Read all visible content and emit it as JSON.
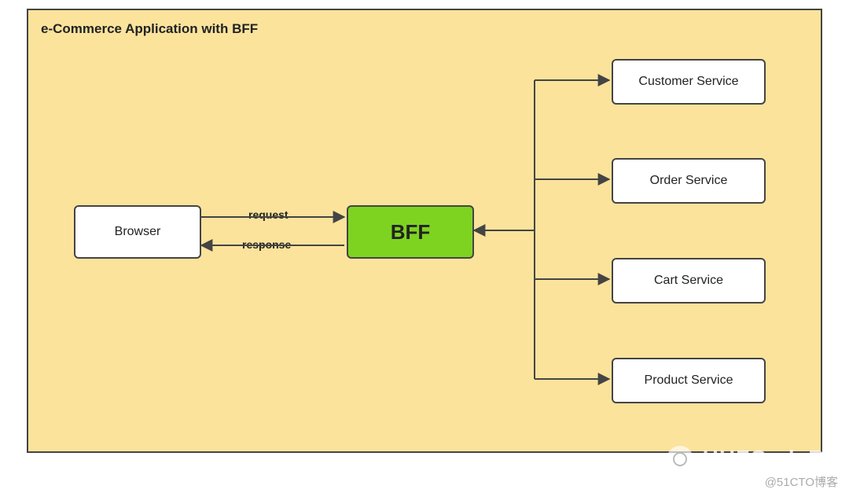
{
  "diagram": {
    "title": "e-Commerce Application with BFF",
    "nodes": {
      "browser": "Browser",
      "bff": "BFF",
      "customer": "Customer Service",
      "order": "Order Service",
      "cart": "Cart Service",
      "product": "Product Service"
    },
    "edges": {
      "request": "request",
      "response": "response"
    }
  },
  "watermarks": {
    "channel": "HHFCodeRv",
    "source": "@51CTO博客"
  }
}
